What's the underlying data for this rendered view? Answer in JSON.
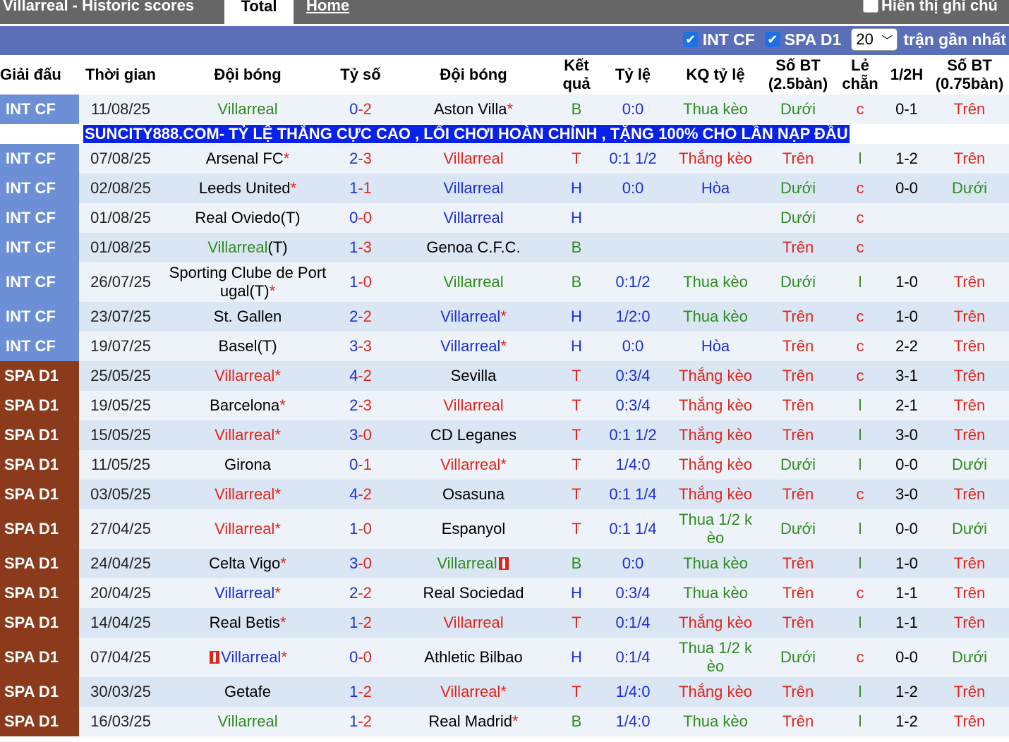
{
  "header": {
    "title": "Villarreal - Historic scores",
    "tab_total": "Total",
    "tab_home": "Home",
    "note_label": "Hiển thị ghi chú"
  },
  "filters": {
    "int_cf": "INT CF",
    "spa_d1": "SPA D1",
    "count_value": "20",
    "count_suffix": "trận gần nhất"
  },
  "columns": [
    "Giải đấu",
    "Thời gian",
    "Đội bóng",
    "Tỷ số",
    "Đội bóng",
    "Kết quả",
    "Tỷ lệ",
    "KQ tỷ lệ",
    "Số BT (2.5bàn)",
    "Lẻ chẵn",
    "1/2H",
    "Số BT (0.75bàn)"
  ],
  "ad_text": "SUNCITY888.COM- TỶ LỆ THẮNG CỰC CAO , LỐI CHƠI HOÀN CHỈNH , TẶNG 100% CHO LẦN NẠP ĐẦU",
  "rows": [
    {
      "league": "INT CF",
      "date": "11/08/25",
      "home": "Villarreal",
      "home_star": "",
      "away": "Aston Villa",
      "away_star": "*",
      "score_h": "0",
      "score_a": "2",
      "result": "B",
      "handicap": "0:0",
      "hc_result": "Thua kèo",
      "ou": "Dưới",
      "oe": "c",
      "half": "0-1",
      "ou2": "Trên"
    },
    {
      "league": "INT CF",
      "date": "07/08/25",
      "home": "Arsenal FC",
      "home_star": "*",
      "away": "Villarreal",
      "away_star": "",
      "score_h": "2",
      "score_a": "3",
      "result": "T",
      "handicap": "0:1 1/2",
      "hc_result": "Thắng kèo",
      "ou": "Trên",
      "oe": "l",
      "half": "1-2",
      "ou2": "Trên"
    },
    {
      "league": "INT CF",
      "date": "02/08/25",
      "home": "Leeds United",
      "home_star": "*",
      "away": "Villarreal",
      "away_star": "",
      "score_h": "1",
      "score_a": "1",
      "result": "H",
      "handicap": "0:0",
      "hc_result": "Hòa",
      "ou": "Dưới",
      "oe": "c",
      "half": "0-0",
      "ou2": "Dưới"
    },
    {
      "league": "INT CF",
      "date": "01/08/25",
      "home": "Real Oviedo(T)",
      "home_star": "",
      "away": "Villarreal",
      "away_star": "",
      "score_h": "0",
      "score_a": "0",
      "result": "H",
      "handicap": "",
      "hc_result": "",
      "ou": "Dưới",
      "oe": "c",
      "half": "",
      "ou2": ""
    },
    {
      "league": "INT CF",
      "date": "01/08/25",
      "home": "Villarreal",
      "home_suffix": "(T)",
      "home_star": "",
      "away": "Genoa C.F.C.",
      "away_star": "",
      "score_h": "1",
      "score_a": "3",
      "result": "B",
      "handicap": "",
      "hc_result": "",
      "ou": "Trên",
      "oe": "c",
      "half": "",
      "ou2": ""
    },
    {
      "league": "INT CF",
      "date": "26/07/25",
      "home": "Sporting Clube de Port ugal(T)",
      "home_star": "*",
      "away": "Villarreal",
      "away_star": "",
      "score_h": "1",
      "score_a": "0",
      "result": "B",
      "handicap": "0:1/2",
      "hc_result": "Thua kèo",
      "ou": "Dưới",
      "oe": "l",
      "half": "1-0",
      "ou2": "Trên"
    },
    {
      "league": "INT CF",
      "date": "23/07/25",
      "home": "St. Gallen",
      "home_star": "",
      "away": "Villarreal",
      "away_star": "*",
      "score_h": "2",
      "score_a": "2",
      "result": "H",
      "handicap": "1/2:0",
      "hc_result": "Thua kèo",
      "ou": "Trên",
      "oe": "c",
      "half": "1-0",
      "ou2": "Trên"
    },
    {
      "league": "INT CF",
      "date": "19/07/25",
      "home": "Basel(T)",
      "home_star": "",
      "away": "Villarreal",
      "away_star": "*",
      "score_h": "3",
      "score_a": "3",
      "result": "H",
      "handicap": "0:0",
      "hc_result": "Hòa",
      "ou": "Trên",
      "oe": "c",
      "half": "2-2",
      "ou2": "Trên"
    },
    {
      "league": "SPA D1",
      "date": "25/05/25",
      "home": "Villarreal",
      "home_star": "*",
      "away": "Sevilla",
      "away_star": "",
      "score_h": "4",
      "score_a": "2",
      "result": "T",
      "handicap": "0:3/4",
      "hc_result": "Thắng kèo",
      "ou": "Trên",
      "oe": "c",
      "half": "3-1",
      "ou2": "Trên"
    },
    {
      "league": "SPA D1",
      "date": "19/05/25",
      "home": "Barcelona",
      "home_star": "*",
      "away": "Villarreal",
      "away_star": "",
      "score_h": "2",
      "score_a": "3",
      "result": "T",
      "handicap": "0:3/4",
      "hc_result": "Thắng kèo",
      "ou": "Trên",
      "oe": "l",
      "half": "2-1",
      "ou2": "Trên"
    },
    {
      "league": "SPA D1",
      "date": "15/05/25",
      "home": "Villarreal",
      "home_star": "*",
      "away": "CD Leganes",
      "away_star": "",
      "score_h": "3",
      "score_a": "0",
      "result": "T",
      "handicap": "0:1 1/2",
      "hc_result": "Thắng kèo",
      "ou": "Trên",
      "oe": "l",
      "half": "3-0",
      "ou2": "Trên"
    },
    {
      "league": "SPA D1",
      "date": "11/05/25",
      "home": "Girona",
      "home_star": "",
      "away": "Villarreal",
      "away_star": "*",
      "score_h": "0",
      "score_a": "1",
      "result": "T",
      "handicap": "1/4:0",
      "hc_result": "Thắng kèo",
      "ou": "Dưới",
      "oe": "l",
      "half": "0-0",
      "ou2": "Dưới"
    },
    {
      "league": "SPA D1",
      "date": "03/05/25",
      "home": "Villarreal",
      "home_star": "*",
      "away": "Osasuna",
      "away_star": "",
      "score_h": "4",
      "score_a": "2",
      "result": "T",
      "handicap": "0:1 1/4",
      "hc_result": "Thắng kèo",
      "ou": "Trên",
      "oe": "c",
      "half": "3-0",
      "ou2": "Trên"
    },
    {
      "league": "SPA D1",
      "date": "27/04/25",
      "home": "Villarreal",
      "home_star": "*",
      "away": "Espanyol",
      "away_star": "",
      "score_h": "1",
      "score_a": "0",
      "result": "T",
      "handicap": "0:1 1/4",
      "hc_result": "Thua 1/2 k èo",
      "ou": "Dưới",
      "oe": "l",
      "half": "0-0",
      "ou2": "Dưới"
    },
    {
      "league": "SPA D1",
      "date": "24/04/25",
      "home": "Celta Vigo",
      "home_star": "*",
      "away": "Villarreal",
      "away_star": "",
      "away_flag": "red-card-icon",
      "score_h": "3",
      "score_a": "0",
      "result": "B",
      "handicap": "0:0",
      "hc_result": "Thua kèo",
      "ou": "Trên",
      "oe": "l",
      "half": "1-0",
      "ou2": "Trên"
    },
    {
      "league": "SPA D1",
      "date": "20/04/25",
      "home": "Villarreal",
      "home_star": "*",
      "away": "Real Sociedad",
      "away_star": "",
      "score_h": "2",
      "score_a": "2",
      "result": "H",
      "handicap": "0:3/4",
      "hc_result": "Thua kèo",
      "ou": "Trên",
      "oe": "c",
      "half": "1-1",
      "ou2": "Trên"
    },
    {
      "league": "SPA D1",
      "date": "14/04/25",
      "home": "Real Betis",
      "home_star": "*",
      "away": "Villarreal",
      "away_star": "",
      "score_h": "1",
      "score_a": "2",
      "result": "T",
      "handicap": "0:1/4",
      "hc_result": "Thắng kèo",
      "ou": "Trên",
      "oe": "l",
      "half": "1-1",
      "ou2": "Trên"
    },
    {
      "league": "SPA D1",
      "date": "07/04/25",
      "home": "Villarreal",
      "home_star": "*",
      "home_flag": "red-card-icon",
      "away": "Athletic Bilbao",
      "away_star": "",
      "score_h": "0",
      "score_a": "0",
      "result": "H",
      "handicap": "0:1/4",
      "hc_result": "Thua 1/2 k èo",
      "ou": "Dưới",
      "oe": "c",
      "half": "0-0",
      "ou2": "Dưới"
    },
    {
      "league": "SPA D1",
      "date": "30/03/25",
      "home": "Getafe",
      "home_star": "",
      "away": "Villarreal",
      "away_star": "*",
      "score_h": "1",
      "score_a": "2",
      "result": "T",
      "handicap": "1/4:0",
      "hc_result": "Thắng kèo",
      "ou": "Trên",
      "oe": "l",
      "half": "1-2",
      "ou2": "Trên"
    },
    {
      "league": "SPA D1",
      "date": "16/03/25",
      "home": "Villarreal",
      "home_star": "",
      "away": "Real Madrid",
      "away_star": "*",
      "score_h": "1",
      "score_a": "2",
      "result": "B",
      "handicap": "1/4:0",
      "hc_result": "Thua kèo",
      "ou": "Trên",
      "oe": "l",
      "half": "1-2",
      "ou2": "Trên"
    }
  ],
  "colors": {
    "win": "#e0251b",
    "draw": "#1c2fd4",
    "loss": "#2e8b1e",
    "int_league": "#6c8fd6",
    "spa_league": "#8b3a1c",
    "filter_bar": "#5b6fb8",
    "ad_bg": "#0a21e8"
  }
}
